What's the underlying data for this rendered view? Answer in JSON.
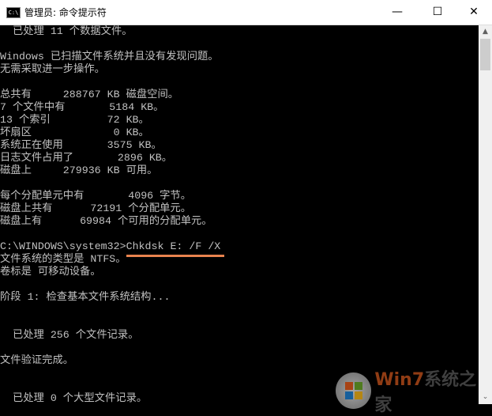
{
  "window": {
    "title": "管理员: 命令提示符",
    "icon": "cmd-icon",
    "minimize": "—",
    "maximize": "☐",
    "close": "✕"
  },
  "console": {
    "lines": [
      "  已处理 11 个数据文件。",
      "",
      "Windows 已扫描文件系统并且没有发现问题。",
      "无需采取进一步操作。",
      "",
      "总共有     288767 KB 磁盘空间。",
      "7 个文件中有       5184 KB。",
      "13 个索引         72 KB。",
      "坏扇区             0 KB。",
      "系统正在使用       3575 KB。",
      "日志文件占用了       2896 KB。",
      "磁盘上     279936 KB 可用。",
      "",
      "每个分配单元中有       4096 字节。",
      "磁盘上共有      72191 个分配单元。",
      "磁盘上有      69984 个可用的分配单元。",
      "",
      "C:\\WINDOWS\\system32>Chkdsk E: /F /X",
      "文件系统的类型是 NTFS。",
      "卷标是 可移动设备。",
      "",
      "阶段 1: 检查基本文件系统结构...",
      "",
      "",
      "  已处理 256 个文件记录。",
      "",
      "文件验证完成。",
      "",
      "",
      "  已处理 0 个大型文件记录。"
    ]
  },
  "watermark": {
    "brand_w": "Win7",
    "brand_rest": "系统之家"
  },
  "scrollbar": {
    "up": "▲",
    "down": "⌄"
  }
}
